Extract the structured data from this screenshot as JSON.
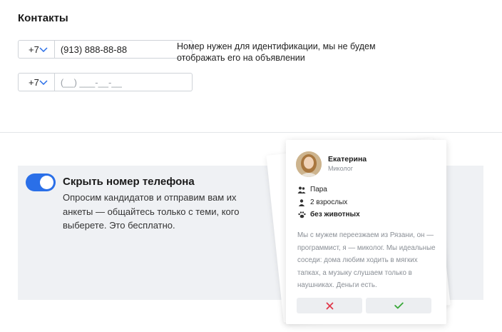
{
  "contacts": {
    "title": "Контакты",
    "phones": [
      {
        "code": "+7",
        "value": "(913) 888-88-88",
        "placeholder": ""
      },
      {
        "code": "+7",
        "value": "",
        "placeholder": "(__) ___-__-__"
      }
    ],
    "hint": "Номер нужен для идентификации, мы не будем отображать его на объявлении"
  },
  "hide_phone": {
    "enabled": true,
    "title": "Скрыть номер телефона",
    "description": "Опросим кандидатов и отправим вам их анкеты — общайтесь только с теми, кого выберете. Это бесплатно."
  },
  "card": {
    "name": "Екатерина",
    "role": "Миколог",
    "attributes": [
      {
        "icon": "couple-icon",
        "text": "Пара"
      },
      {
        "icon": "person-icon",
        "text": "2 взрослых"
      },
      {
        "icon": "paw-icon",
        "text": "без животных"
      }
    ],
    "about": "Мы с мужем переезжаем из Рязани, он — программист, я — миколог. Мы идеальные соседи: дома любим ходить в мягких тапках, а музыку слушаем только в наушниках. Деньги есть.",
    "reject_icon": "cross-icon",
    "accept_icon": "check-icon"
  },
  "colors": {
    "accent": "#2a6fe8",
    "panel": "#eff1f4",
    "reject": "#e0394b",
    "accept": "#3aa83a",
    "muted": "#8a8f96"
  }
}
